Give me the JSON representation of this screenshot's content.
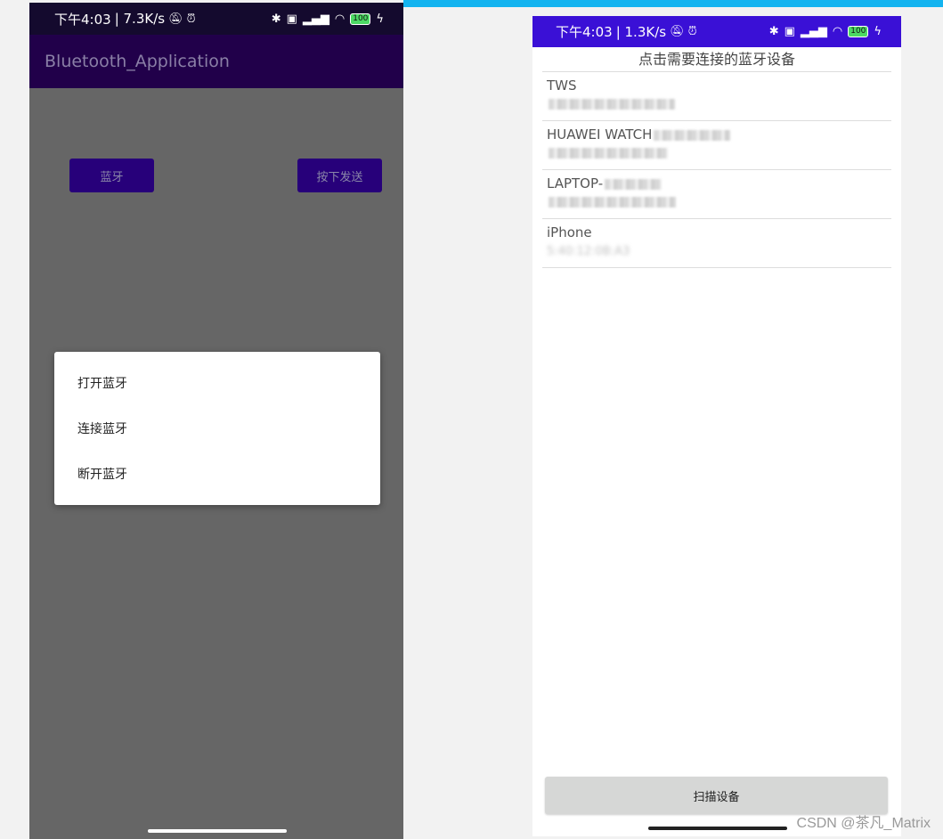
{
  "left_screen": {
    "status_bar": {
      "time": "下午4:03",
      "net_speed": "| 7.3K/s",
      "icons": [
        "mute-icon",
        "alarm-icon",
        "bluetooth-icon",
        "hd-icon",
        "signal-icon",
        "wifi-icon",
        "battery-icon",
        "charging-icon"
      ],
      "battery": "100"
    },
    "app_title": "Bluetooth_Application",
    "buttons": {
      "bluetooth": "蓝牙",
      "send": "按下发送"
    },
    "menu": {
      "items": [
        "打开蓝牙",
        "连接蓝牙",
        "断开蓝牙"
      ]
    }
  },
  "right_screen": {
    "status_bar": {
      "time": "下午4:03",
      "net_speed": "| 1.3K/s",
      "battery": "100"
    },
    "list_header": "点击需要连接的蓝牙设备",
    "devices": [
      {
        "name": "TWS"
      },
      {
        "name": "HUAWEI WATCH"
      },
      {
        "name": "LAPTOP-"
      },
      {
        "name": "iPhone",
        "address": "5:40:12:0B:A3"
      }
    ],
    "scan_button": "扫描设备"
  },
  "watermark": "CSDN @茶凡_Matrix",
  "colors": {
    "app_bar": "#21004a",
    "button": "#27007a",
    "right_status_bar": "#3a10d6",
    "accent": "#14b4f0"
  }
}
